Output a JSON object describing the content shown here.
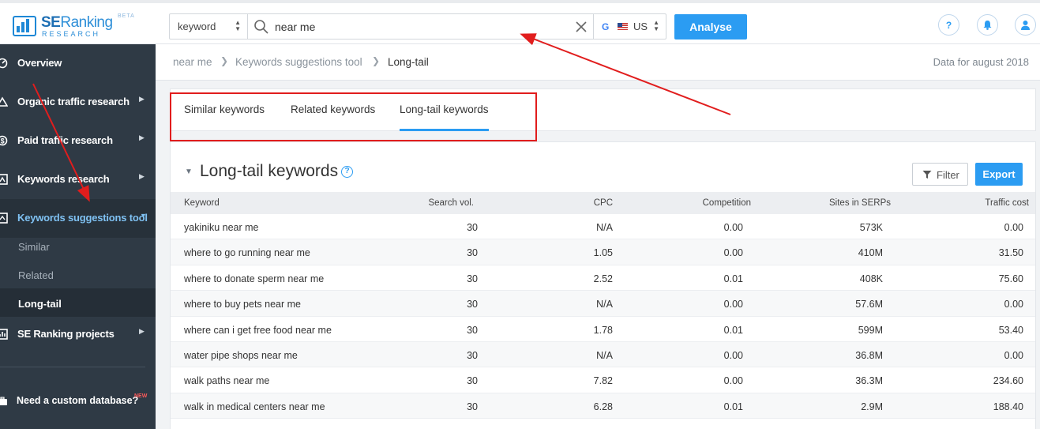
{
  "brand": {
    "name_se": "SE",
    "name_ranking": "Ranking",
    "sub": "RESEARCH",
    "badge": "BETA"
  },
  "search": {
    "mode": "keyword",
    "query": "near me",
    "region": "US",
    "analyse_label": "Analyse"
  },
  "sidebar": {
    "items": [
      {
        "label": "Overview"
      },
      {
        "label": "Organic traffic research"
      },
      {
        "label": "Paid traffic research"
      },
      {
        "label": "Keywords research"
      },
      {
        "label": "Keywords suggestions tool"
      },
      {
        "label": "SE Ranking projects"
      }
    ],
    "subitems": [
      {
        "label": "Similar"
      },
      {
        "label": "Related"
      },
      {
        "label": "Long-tail"
      }
    ],
    "custom_db": {
      "label": "Need a custom database?",
      "badge": "NEW"
    }
  },
  "breadcrumb": {
    "items": [
      "near me",
      "Keywords suggestions tool",
      "Long-tail"
    ],
    "data_for": "Data for august 2018"
  },
  "tabs": [
    "Similar keywords",
    "Related keywords",
    "Long-tail keywords"
  ],
  "section": {
    "title": "Long-tail keywords",
    "filter_label": "Filter",
    "export_label": "Export"
  },
  "table": {
    "headers": [
      "Keyword",
      "Search vol.",
      "CPC",
      "Competition",
      "Sites in SERPs",
      "Traffic cost"
    ],
    "rows": [
      [
        "yakiniku near me",
        "30",
        "N/A",
        "0.00",
        "573K",
        "0.00"
      ],
      [
        "where to go running near me",
        "30",
        "1.05",
        "0.00",
        "410M",
        "31.50"
      ],
      [
        "where to donate sperm near me",
        "30",
        "2.52",
        "0.01",
        "408K",
        "75.60"
      ],
      [
        "where to buy pets near me",
        "30",
        "N/A",
        "0.00",
        "57.6M",
        "0.00"
      ],
      [
        "where can i get free food near me",
        "30",
        "1.78",
        "0.01",
        "599M",
        "53.40"
      ],
      [
        "water pipe shops near me",
        "30",
        "N/A",
        "0.00",
        "36.8M",
        "0.00"
      ],
      [
        "walk paths near me",
        "30",
        "7.82",
        "0.00",
        "36.3M",
        "234.60"
      ],
      [
        "walk in medical centers near me",
        "30",
        "6.28",
        "0.01",
        "2.9M",
        "188.40"
      ]
    ]
  },
  "colors": {
    "accent": "#2b9cf2",
    "sidebar": "#2f3a45",
    "annotation": "#e11d1d"
  }
}
